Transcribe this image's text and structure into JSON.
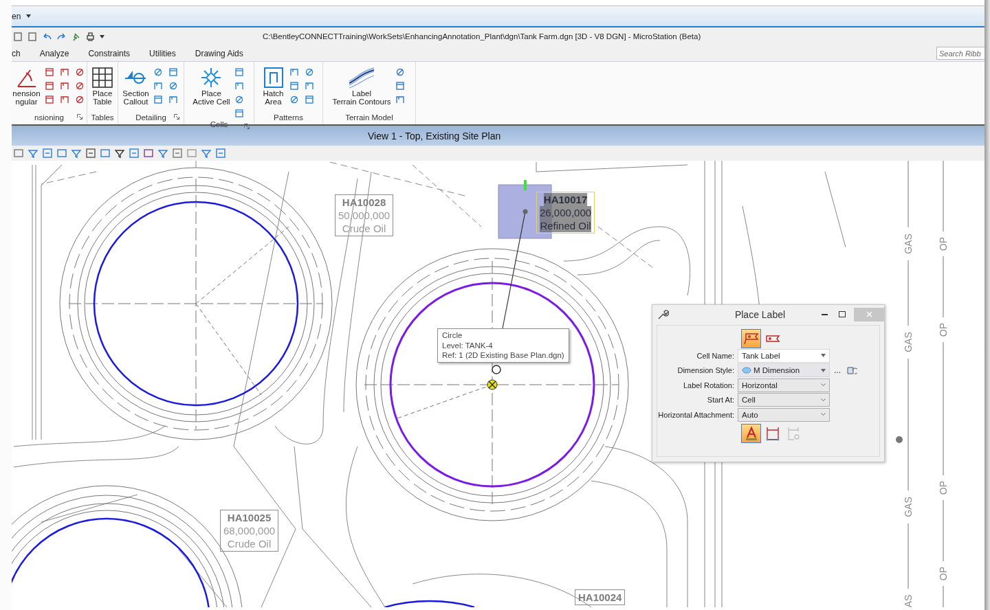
{
  "app_bar": {
    "menu": "en"
  },
  "title_bar": {
    "title": "C:\\BentleyCONNECTTraining\\WorkSets\\EnhancingAnnotation_Plant\\dgn\\Tank Farm.dgn [3D - V8 DGN] - MicroStation (Beta)"
  },
  "ribbon_tabs": [
    "ch",
    "Analyze",
    "Constraints",
    "Utilities",
    "Drawing Aids"
  ],
  "search": {
    "placeholder": "Search Ribb"
  },
  "ribbon_groups": [
    {
      "label": "nsioning",
      "launcher": true,
      "tools": [
        {
          "lines": [
            "nension",
            "ngular"
          ]
        }
      ]
    },
    {
      "label": "Tables",
      "launcher": false,
      "tools": [
        {
          "lines": [
            "Place",
            "Table"
          ]
        }
      ]
    },
    {
      "label": "Detailing",
      "launcher": true,
      "tools": [
        {
          "lines": [
            "Section",
            "Callout"
          ]
        }
      ]
    },
    {
      "label": "Cells",
      "launcher": true,
      "tools": [
        {
          "lines": [
            "Place",
            "Active Cell"
          ]
        }
      ]
    },
    {
      "label": "Patterns",
      "launcher": false,
      "tools": [
        {
          "lines": [
            "Hatch",
            "Area"
          ]
        }
      ]
    },
    {
      "label": "Terrain Model",
      "launcher": false,
      "tools": [
        {
          "lines": [
            "Label",
            "Terrain Contours"
          ]
        }
      ]
    }
  ],
  "view": {
    "title": "View 1 - Top, Existing Site Plan"
  },
  "tank_labels": [
    {
      "lines": [
        "HA10028",
        "50,000,000",
        "Crude Oil"
      ],
      "selected": false
    },
    {
      "lines": [
        "HA10017",
        "26,000,000",
        "Refined Oil"
      ],
      "selected": true
    },
    {
      "lines": [
        "HA10025",
        "68,000,000",
        "Crude Oil"
      ],
      "selected": false
    },
    {
      "lines": [
        "HA10024"
      ],
      "selected": false
    }
  ],
  "tooltip": {
    "lines": [
      "Circle",
      "Level: TANK-4",
      "Ref: 1 (2D Existing Base Plan.dgn)"
    ]
  },
  "gas_line": [
    "GAS",
    "GAS",
    "GAS",
    "AS"
  ],
  "op_line": [
    "OP",
    "OP",
    "OP",
    "OP"
  ],
  "dialog": {
    "title": "Place Label",
    "mode_buttons": [
      {
        "selected": true
      },
      {
        "selected": false
      }
    ],
    "fields": [
      {
        "label": "Cell Name:",
        "value": "Tank Label",
        "kind": "combo"
      },
      {
        "label": "Dimension Style:",
        "value": "M Dimension",
        "kind": "style"
      },
      {
        "label": "Label Rotation:",
        "value": "Horizontal",
        "kind": "list"
      },
      {
        "label": "Start At:",
        "value": "Cell",
        "kind": "list"
      },
      {
        "label": "Horizontal Attachment:",
        "value": "Auto",
        "kind": "list"
      }
    ],
    "more": "...",
    "attach_buttons": [
      {
        "selected": true,
        "disabled": false
      },
      {
        "selected": false,
        "disabled": false
      },
      {
        "selected": false,
        "disabled": true
      }
    ]
  }
}
